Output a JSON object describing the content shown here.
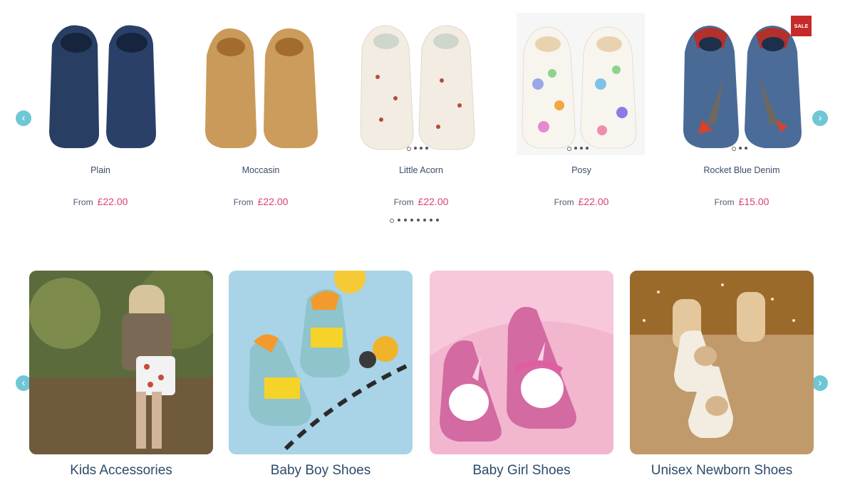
{
  "products": [
    {
      "name": "Plain",
      "price_prefix": "From",
      "price": "£22.00"
    },
    {
      "name": "Moccasin",
      "price_prefix": "From",
      "price": "£22.00"
    },
    {
      "name": "Little Acorn",
      "price_prefix": "From",
      "price": "£22.00"
    },
    {
      "name": "Posy",
      "price_prefix": "From",
      "price": "£22.00"
    },
    {
      "name": "Rocket Blue Denim",
      "price_prefix": "From",
      "price": "£15.00",
      "badge": "SALE"
    }
  ],
  "carousel": {
    "prev_icon": "‹",
    "next_icon": "›",
    "page_count": 8,
    "active_page": 1
  },
  "categories": [
    {
      "label": "Kids Accessories"
    },
    {
      "label": "Baby Boy Shoes"
    },
    {
      "label": "Baby Girl Shoes"
    },
    {
      "label": "Unisex Newborn Shoes"
    }
  ],
  "colors": {
    "accent": "#6fc7d6",
    "price": "#d9407a",
    "sale": "#c62a2a"
  }
}
